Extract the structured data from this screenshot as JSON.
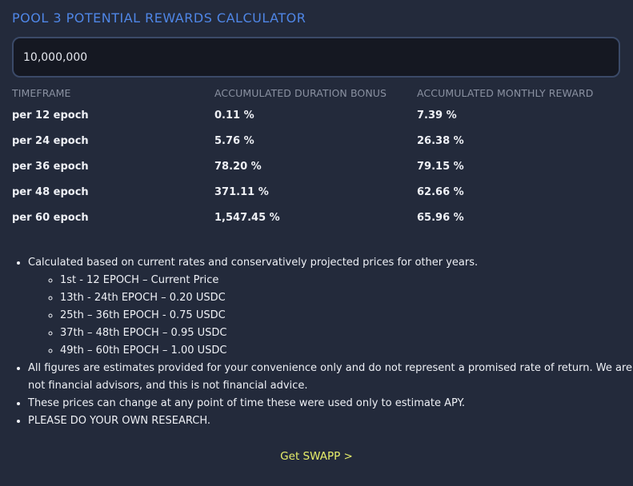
{
  "header": {
    "title": "POOL 3 POTENTIAL REWARDS CALCULATOR"
  },
  "input": {
    "value": "10,000,000"
  },
  "table": {
    "columns": [
      "TIMEFRAME",
      "ACCUMULATED DURATION BONUS",
      "ACCUMULATED MONTHLY REWARD"
    ],
    "rows": [
      [
        "per 12 epoch",
        "0.11 %",
        "7.39 %"
      ],
      [
        "per 24 epoch",
        "5.76 %",
        "26.38 %"
      ],
      [
        "per 36 epoch",
        "78.20 %",
        "79.15 %"
      ],
      [
        "per 48 epoch",
        "371.11 %",
        "62.66 %"
      ],
      [
        "per 60 epoch",
        "1,547.45 %",
        "65.96 %"
      ]
    ]
  },
  "notes": {
    "intro": "Calculated based on current rates and conservatively projected prices for other years.",
    "prices": [
      "1st - 12 EPOCH – Current Price",
      "13th - 24th EPOCH – 0.20 USDC",
      "25th – 36th EPOCH - 0.75 USDC",
      "37th – 48th EPOCH – 0.95 USDC",
      "49th – 60th EPOCH – 1.00 USDC"
    ],
    "disclaimer": "All figures are estimates provided for your convenience only and do not represent a promised rate of return. We are not financial advisors, and this is not financial advice.",
    "change": "These prices can change at any point of time these were used only to estimate APY.",
    "research": "PLEASE DO YOUR OWN RESEARCH."
  },
  "cta": {
    "label": "Get SWAPP >"
  },
  "colors": {
    "background": "#232a3b",
    "title": "#4f86e6",
    "input_bg": "#151822",
    "input_border": "#3b4a68",
    "cta": "#e8ef6a"
  }
}
